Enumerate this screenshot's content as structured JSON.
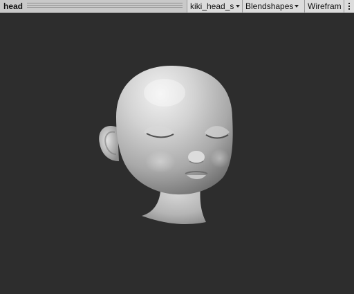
{
  "toolbar": {
    "title": "head",
    "mesh_dropdown": "kiki_head_sha",
    "blendshapes_dropdown": "Blendshapes",
    "wireframe_button": "Wireframe",
    "more_icon": "vertical-ellipsis-icon"
  },
  "viewport": {
    "background": "#2d2d2d",
    "content": "head-mesh-preview",
    "shading": "lit-grey"
  }
}
